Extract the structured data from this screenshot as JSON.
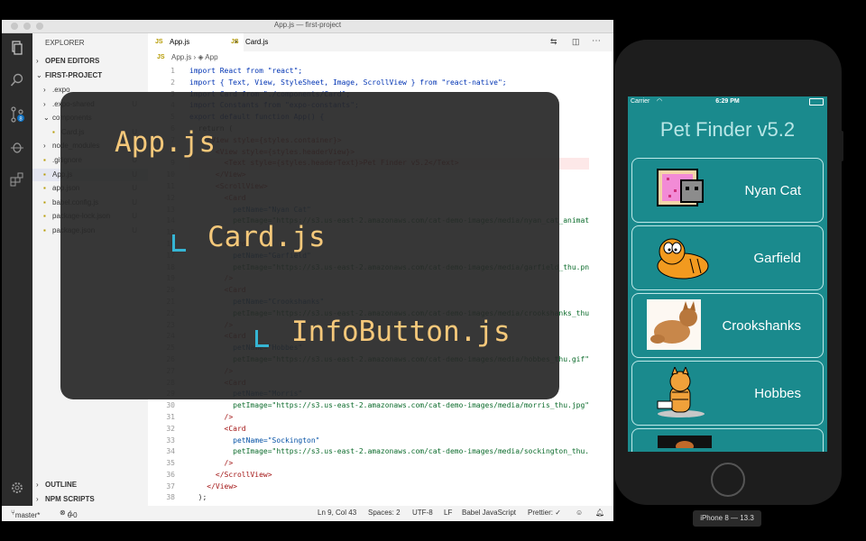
{
  "window": {
    "title": "App.js — first-project"
  },
  "sidebar": {
    "explorer_label": "EXPLORER",
    "open_editors": "OPEN EDITORS",
    "project": "FIRST-PROJECT",
    "files": [
      {
        "name": ".expo",
        "status": ""
      },
      {
        "name": ".expo-shared",
        "status": "U"
      },
      {
        "name": "components",
        "status": ""
      },
      {
        "name": "Card.js",
        "status": "U"
      },
      {
        "name": "node_modules",
        "status": ""
      },
      {
        "name": ".gitignore",
        "status": "U"
      },
      {
        "name": "App.js",
        "status": "U"
      },
      {
        "name": "app.json",
        "status": "U"
      },
      {
        "name": "babel.config.js",
        "status": "U"
      },
      {
        "name": "package-lock.json",
        "status": "U"
      },
      {
        "name": "package.json",
        "status": "U"
      }
    ],
    "outline": "OUTLINE",
    "npm_scripts": "NPM SCRIPTS"
  },
  "editor": {
    "tabs": [
      {
        "label": "App.js"
      },
      {
        "label": "Card.js"
      }
    ],
    "tab_icon": "JS",
    "breadcrumb": {
      "file": "App.js",
      "symbol": "App"
    },
    "line_numbers": [
      "1",
      "2",
      "3",
      "4",
      "5",
      "6",
      "7",
      "8",
      "9",
      "10",
      "11",
      "12",
      "13",
      "14",
      "15",
      "16",
      "17",
      "18",
      "19",
      "20",
      "21",
      "22",
      "23",
      "24",
      "25",
      "26",
      "27",
      "28",
      "29",
      "30",
      "31",
      "32",
      "33",
      "34",
      "35",
      "36",
      "37",
      "38"
    ],
    "lines": [
      "import React from \"react\";",
      "import { Text, View, StyleSheet, Image, ScrollView } from \"react-native\";",
      "import Card from \"./components/Card\";",
      "import Constants from \"expo-constants\";",
      "export default function App() {",
      "  return (",
      "    <View style={styles.container}>",
      "      <View style={styles.headerView}>",
      "        <Text style={styles.headerText}>Pet Finder v5.2</Text>",
      "      </View>",
      "      <ScrollView>",
      "        <Card",
      "          petName=\"Nyan Cat\"",
      "          petImage=\"https://s3.us-east-2.amazonaws.com/cat-demo-images/media/nyan_cat_animat",
      "        />",
      "        <Card",
      "          petName=\"Garfield\"",
      "          petImage=\"https://s3.us-east-2.amazonaws.com/cat-demo-images/media/garfield_thu.pn",
      "        />",
      "        <Card",
      "          petName=\"Crookshanks\"",
      "          petImage=\"https://s3.us-east-2.amazonaws.com/cat-demo-images/media/crookshanks_thu",
      "        />",
      "        <Card",
      "          petName=\"Hobbes\"",
      "          petImage=\"https://s3.us-east-2.amazonaws.com/cat-demo-images/media/hobbes_thu.gif\"",
      "        />",
      "        <Card",
      "          petName=\"Morris\"",
      "          petImage=\"https://s3.us-east-2.amazonaws.com/cat-demo-images/media/morris_thu.jpg\"",
      "        />",
      "        <Card",
      "          petName=\"Sockington\"",
      "          petImage=\"https://s3.us-east-2.amazonaws.com/cat-demo-images/media/sockington_thu.",
      "        />",
      "      </ScrollView>",
      "    </View>",
      "  );"
    ]
  },
  "overlay": {
    "items": [
      "App.js",
      "Card.js",
      "InfoButton.js"
    ]
  },
  "statusbar": {
    "branch": "master*",
    "errors": "0",
    "warnings": "0",
    "position": "Ln 9, Col 43",
    "spaces": "Spaces: 2",
    "encoding": "UTF-8",
    "eol": "LF",
    "language": "Babel JavaScript",
    "prettier": "Prettier: ✓"
  },
  "phone": {
    "carrier": "Carrier",
    "time": "6:29 PM",
    "app_title": "Pet Finder v5.2",
    "pets": [
      {
        "name": "Nyan Cat"
      },
      {
        "name": "Garfield"
      },
      {
        "name": "Crookshanks"
      },
      {
        "name": "Hobbes"
      }
    ],
    "device_label": "iPhone 8 — 13.3"
  },
  "colors": {
    "accent_teal": "#1a8a8d",
    "overlay_text": "#f5c87a",
    "tree_line": "#35b5d4"
  }
}
